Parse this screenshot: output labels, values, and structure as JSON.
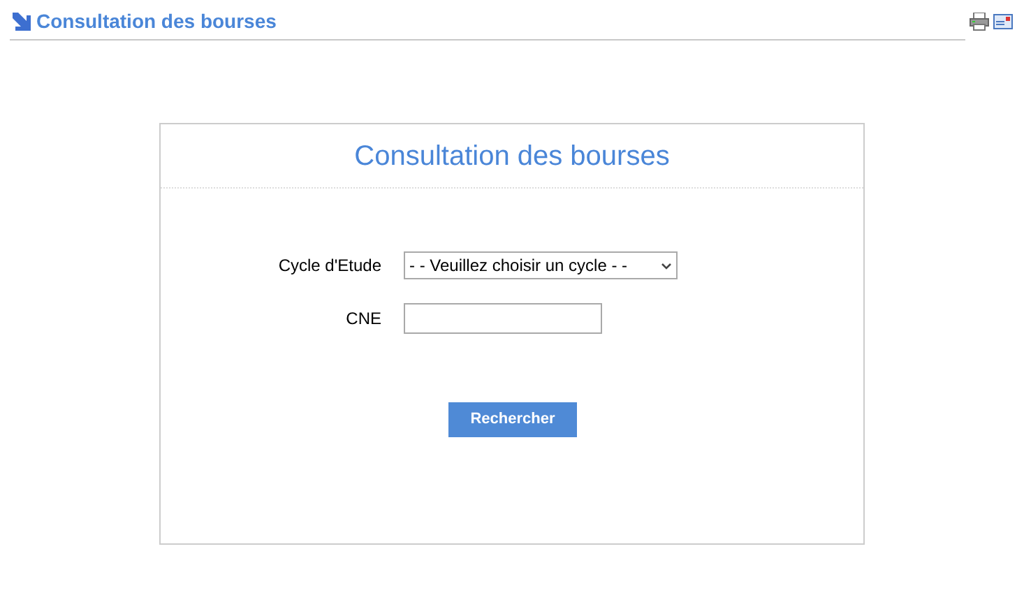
{
  "page_title": "Consultation des bourses",
  "form": {
    "title": "Consultation des bourses",
    "fields": [
      {
        "kind": "select",
        "label": "Cycle d'Etude",
        "value": "- - Veuillez choisir un cycle - -"
      },
      {
        "kind": "text",
        "label": "CNE"
      }
    ],
    "button": "Rechercher"
  }
}
